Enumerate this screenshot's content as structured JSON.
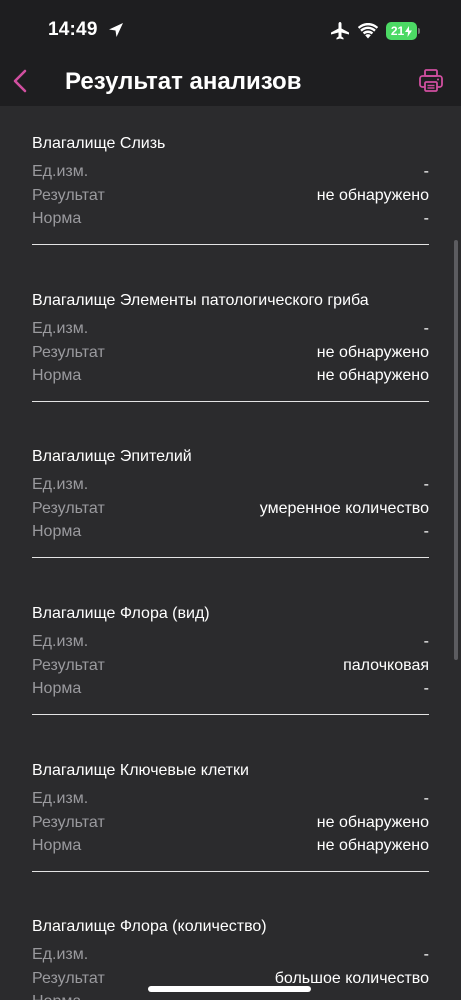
{
  "status_bar": {
    "time": "14:49",
    "battery": "21",
    "icons": [
      "location-arrow-icon",
      "airplane-icon",
      "wifi-icon",
      "battery-charging-icon"
    ]
  },
  "header": {
    "title": "Результат анализов",
    "back_icon": "chevron-left-icon",
    "print_icon": "printer-icon"
  },
  "colors": {
    "accent": "#d14fa0",
    "background": "#2b2b2d",
    "bar_background": "#1e1e20",
    "label": "#9a9a9e",
    "battery": "#4cd964"
  },
  "labels": {
    "unit": "Ед.изм.",
    "result": "Результат",
    "norm": "Норма"
  },
  "results": [
    {
      "name": "Влагалище Слизь",
      "unit": "-",
      "result": "не обнаружено",
      "norm": "-"
    },
    {
      "name": "Влагалище Элементы патологического гриба",
      "unit": "-",
      "result": "не обнаружено",
      "norm": "не обнаружено"
    },
    {
      "name": "Влагалище Эпителий",
      "unit": "-",
      "result": "умеренное количество",
      "norm": "-"
    },
    {
      "name": "Влагалище Флора (вид)",
      "unit": "-",
      "result": "палочковая",
      "norm": "-"
    },
    {
      "name": "Влагалище Ключевые клетки",
      "unit": "-",
      "result": "не обнаружено",
      "norm": "не обнаружено"
    },
    {
      "name": "Влагалище Флора (количество)",
      "unit": "-",
      "result": "большое количество",
      "norm": "-"
    }
  ]
}
